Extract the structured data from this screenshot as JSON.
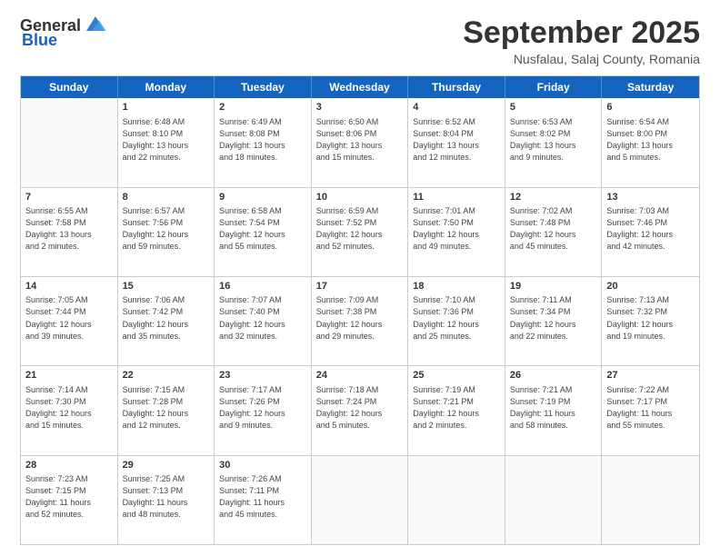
{
  "header": {
    "logo_general": "General",
    "logo_blue": "Blue",
    "month_title": "September 2025",
    "location": "Nusfalau, Salaj County, Romania"
  },
  "days_of_week": [
    "Sunday",
    "Monday",
    "Tuesday",
    "Wednesday",
    "Thursday",
    "Friday",
    "Saturday"
  ],
  "weeks": [
    [
      {
        "day": "",
        "info": ""
      },
      {
        "day": "1",
        "info": "Sunrise: 6:48 AM\nSunset: 8:10 PM\nDaylight: 13 hours\nand 22 minutes."
      },
      {
        "day": "2",
        "info": "Sunrise: 6:49 AM\nSunset: 8:08 PM\nDaylight: 13 hours\nand 18 minutes."
      },
      {
        "day": "3",
        "info": "Sunrise: 6:50 AM\nSunset: 8:06 PM\nDaylight: 13 hours\nand 15 minutes."
      },
      {
        "day": "4",
        "info": "Sunrise: 6:52 AM\nSunset: 8:04 PM\nDaylight: 13 hours\nand 12 minutes."
      },
      {
        "day": "5",
        "info": "Sunrise: 6:53 AM\nSunset: 8:02 PM\nDaylight: 13 hours\nand 9 minutes."
      },
      {
        "day": "6",
        "info": "Sunrise: 6:54 AM\nSunset: 8:00 PM\nDaylight: 13 hours\nand 5 minutes."
      }
    ],
    [
      {
        "day": "7",
        "info": "Sunrise: 6:55 AM\nSunset: 7:58 PM\nDaylight: 13 hours\nand 2 minutes."
      },
      {
        "day": "8",
        "info": "Sunrise: 6:57 AM\nSunset: 7:56 PM\nDaylight: 12 hours\nand 59 minutes."
      },
      {
        "day": "9",
        "info": "Sunrise: 6:58 AM\nSunset: 7:54 PM\nDaylight: 12 hours\nand 55 minutes."
      },
      {
        "day": "10",
        "info": "Sunrise: 6:59 AM\nSunset: 7:52 PM\nDaylight: 12 hours\nand 52 minutes."
      },
      {
        "day": "11",
        "info": "Sunrise: 7:01 AM\nSunset: 7:50 PM\nDaylight: 12 hours\nand 49 minutes."
      },
      {
        "day": "12",
        "info": "Sunrise: 7:02 AM\nSunset: 7:48 PM\nDaylight: 12 hours\nand 45 minutes."
      },
      {
        "day": "13",
        "info": "Sunrise: 7:03 AM\nSunset: 7:46 PM\nDaylight: 12 hours\nand 42 minutes."
      }
    ],
    [
      {
        "day": "14",
        "info": "Sunrise: 7:05 AM\nSunset: 7:44 PM\nDaylight: 12 hours\nand 39 minutes."
      },
      {
        "day": "15",
        "info": "Sunrise: 7:06 AM\nSunset: 7:42 PM\nDaylight: 12 hours\nand 35 minutes."
      },
      {
        "day": "16",
        "info": "Sunrise: 7:07 AM\nSunset: 7:40 PM\nDaylight: 12 hours\nand 32 minutes."
      },
      {
        "day": "17",
        "info": "Sunrise: 7:09 AM\nSunset: 7:38 PM\nDaylight: 12 hours\nand 29 minutes."
      },
      {
        "day": "18",
        "info": "Sunrise: 7:10 AM\nSunset: 7:36 PM\nDaylight: 12 hours\nand 25 minutes."
      },
      {
        "day": "19",
        "info": "Sunrise: 7:11 AM\nSunset: 7:34 PM\nDaylight: 12 hours\nand 22 minutes."
      },
      {
        "day": "20",
        "info": "Sunrise: 7:13 AM\nSunset: 7:32 PM\nDaylight: 12 hours\nand 19 minutes."
      }
    ],
    [
      {
        "day": "21",
        "info": "Sunrise: 7:14 AM\nSunset: 7:30 PM\nDaylight: 12 hours\nand 15 minutes."
      },
      {
        "day": "22",
        "info": "Sunrise: 7:15 AM\nSunset: 7:28 PM\nDaylight: 12 hours\nand 12 minutes."
      },
      {
        "day": "23",
        "info": "Sunrise: 7:17 AM\nSunset: 7:26 PM\nDaylight: 12 hours\nand 9 minutes."
      },
      {
        "day": "24",
        "info": "Sunrise: 7:18 AM\nSunset: 7:24 PM\nDaylight: 12 hours\nand 5 minutes."
      },
      {
        "day": "25",
        "info": "Sunrise: 7:19 AM\nSunset: 7:21 PM\nDaylight: 12 hours\nand 2 minutes."
      },
      {
        "day": "26",
        "info": "Sunrise: 7:21 AM\nSunset: 7:19 PM\nDaylight: 11 hours\nand 58 minutes."
      },
      {
        "day": "27",
        "info": "Sunrise: 7:22 AM\nSunset: 7:17 PM\nDaylight: 11 hours\nand 55 minutes."
      }
    ],
    [
      {
        "day": "28",
        "info": "Sunrise: 7:23 AM\nSunset: 7:15 PM\nDaylight: 11 hours\nand 52 minutes."
      },
      {
        "day": "29",
        "info": "Sunrise: 7:25 AM\nSunset: 7:13 PM\nDaylight: 11 hours\nand 48 minutes."
      },
      {
        "day": "30",
        "info": "Sunrise: 7:26 AM\nSunset: 7:11 PM\nDaylight: 11 hours\nand 45 minutes."
      },
      {
        "day": "",
        "info": ""
      },
      {
        "day": "",
        "info": ""
      },
      {
        "day": "",
        "info": ""
      },
      {
        "day": "",
        "info": ""
      }
    ]
  ]
}
